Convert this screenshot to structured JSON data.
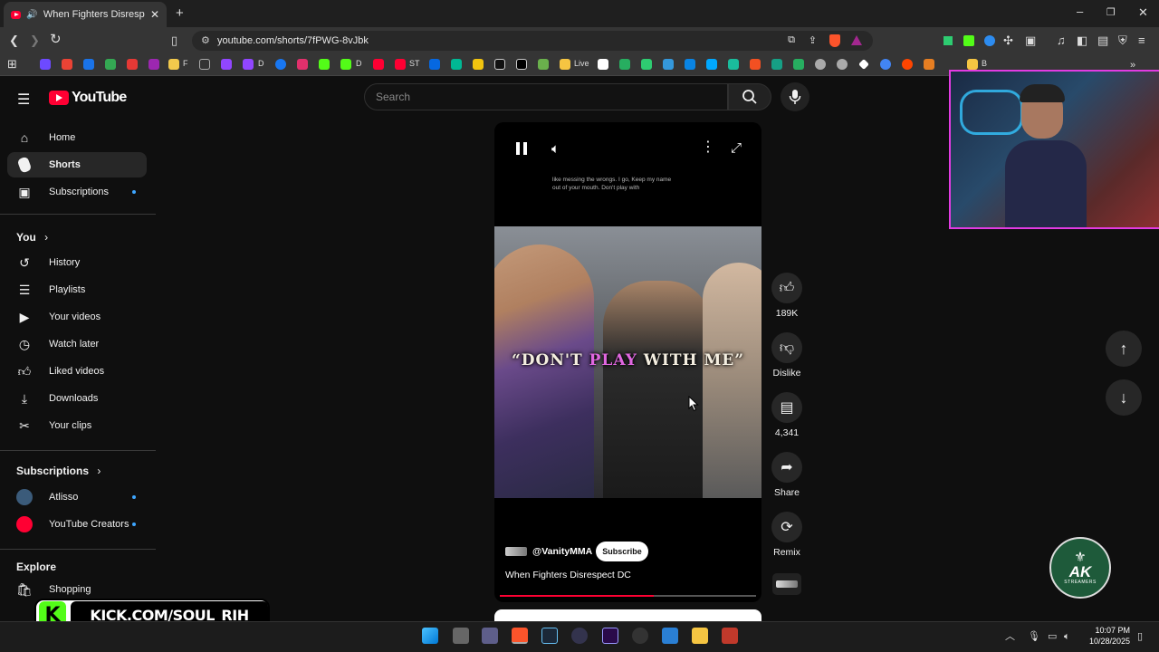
{
  "browser": {
    "tab_title": "When Fighters Disrespect DC",
    "url": "youtube.com/shorts/7fPWG-8vJbk",
    "bookmarks": [
      "F",
      "D",
      "D",
      "ST",
      "Live",
      "B"
    ]
  },
  "youtube": {
    "logo_text": "YouTube",
    "search_placeholder": "Search",
    "sidebar": {
      "main": [
        {
          "label": "Home",
          "icon": "home-icon"
        },
        {
          "label": "Shorts",
          "icon": "shorts-icon"
        },
        {
          "label": "Subscriptions",
          "icon": "subscriptions-icon"
        }
      ],
      "you_header": "You",
      "you": [
        {
          "label": "History",
          "icon": "history-icon"
        },
        {
          "label": "Playlists",
          "icon": "playlists-icon"
        },
        {
          "label": "Your videos",
          "icon": "your-videos-icon"
        },
        {
          "label": "Watch later",
          "icon": "watch-later-icon"
        },
        {
          "label": "Liked videos",
          "icon": "liked-videos-icon"
        },
        {
          "label": "Downloads",
          "icon": "downloads-icon"
        },
        {
          "label": "Your clips",
          "icon": "clips-icon"
        }
      ],
      "subscriptions_header": "Subscriptions",
      "subscriptions": [
        {
          "label": "Atlisso"
        },
        {
          "label": "YouTube Creators"
        }
      ],
      "explore_header": "Explore",
      "explore": [
        {
          "label": "Shopping"
        }
      ]
    },
    "short": {
      "caption_text": "like messing the wrongs. I go, Keep my name out of your mouth. Don't play with",
      "overlay_part1": "“DON'T ",
      "overlay_part2": "PLAY",
      "overlay_part3": " WITH ME”",
      "channel": "@VanityMMA",
      "subscribe_label": "Subscribe",
      "title": "When Fighters Disrespect DC",
      "progress": 0.6
    },
    "actions": {
      "likes": "189K",
      "dislike_label": "Dislike",
      "comments": "4,341",
      "share_label": "Share",
      "remix_label": "Remix"
    }
  },
  "overlay": {
    "kick_text": "KICK.COM/SOUL_RIH",
    "ak_logo_text": "AK",
    "ak_logo_sub": "STREAMERS"
  },
  "taskbar": {
    "time": "10:07 PM",
    "date": "10/28/2025"
  }
}
